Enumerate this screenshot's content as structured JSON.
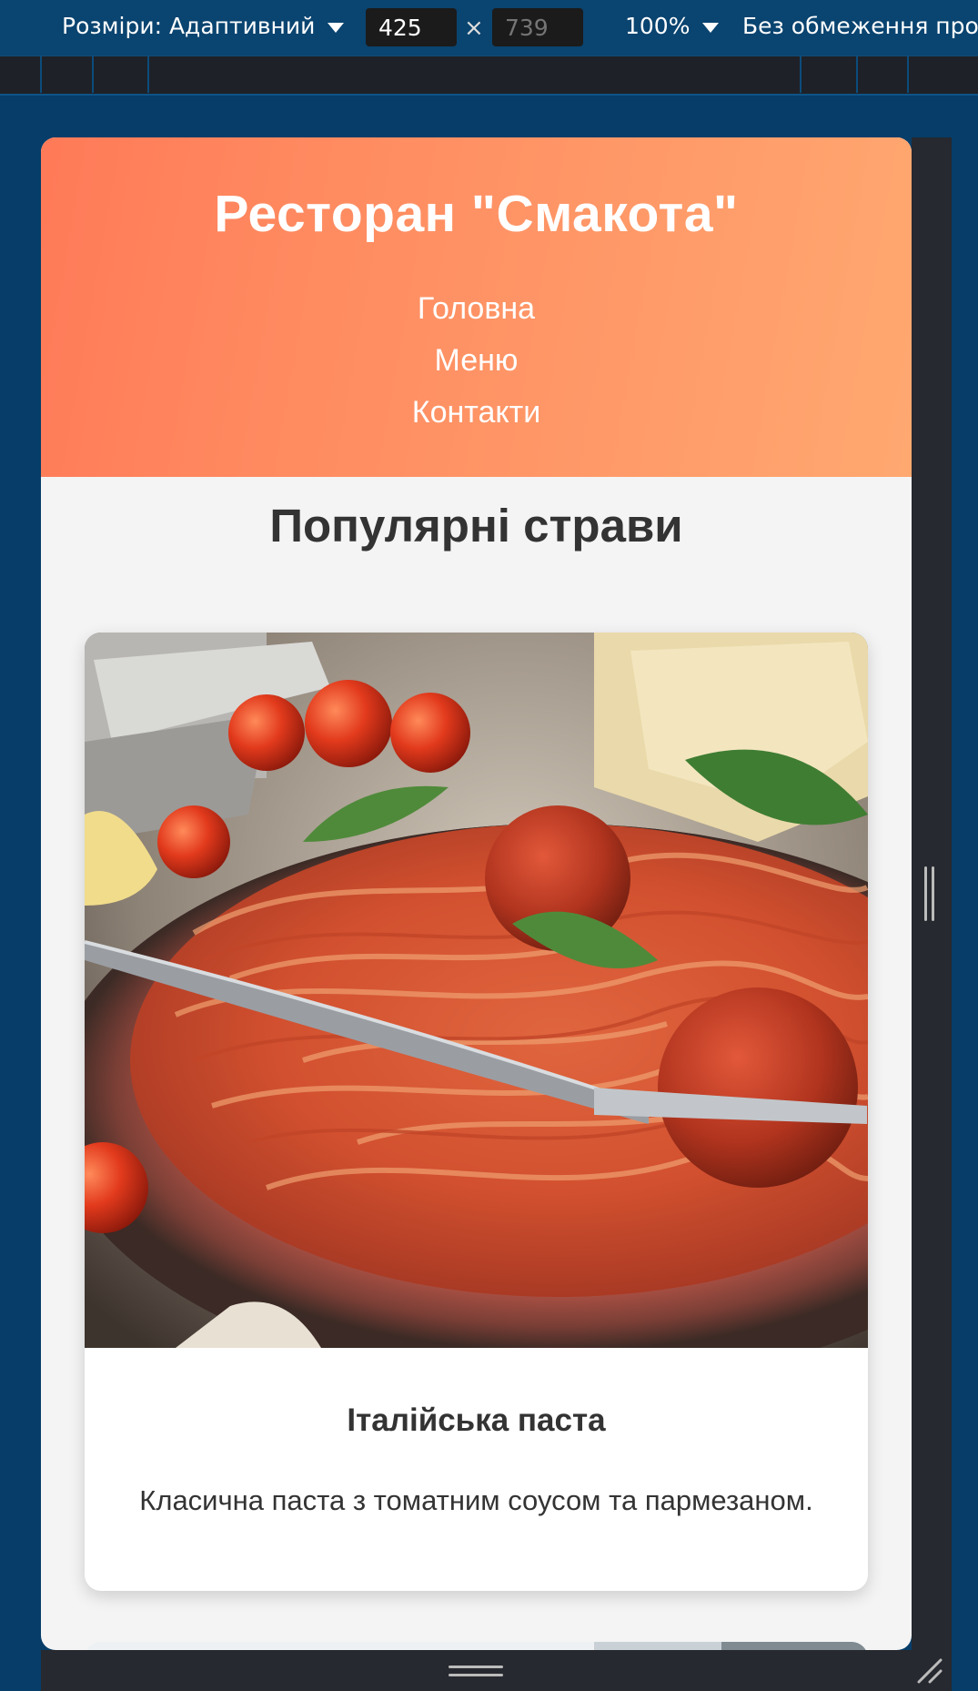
{
  "devtools": {
    "dimensions_label": "Розміри: Адаптивний",
    "width_value": "425",
    "height_placeholder": "739",
    "times_symbol": "×",
    "zoom_label": "100%",
    "throttle_label": "Без обмеження проп"
  },
  "site": {
    "title": "Ресторан \"Смакота\"",
    "nav": [
      {
        "label": "Головна"
      },
      {
        "label": "Меню"
      },
      {
        "label": "Контакти"
      }
    ],
    "section_title": "Популярні страви",
    "cards": [
      {
        "image": "spaghetti-with-meatballs-photo",
        "title": "Італійська паста",
        "description": "Класична паста з томатним соусом та пармезаном."
      }
    ]
  },
  "colors": {
    "header_gradient_start": "#ff7a58",
    "header_gradient_end": "#ffa870",
    "page_background": "#f4f4f4",
    "devtools_background": "#0a4470"
  }
}
